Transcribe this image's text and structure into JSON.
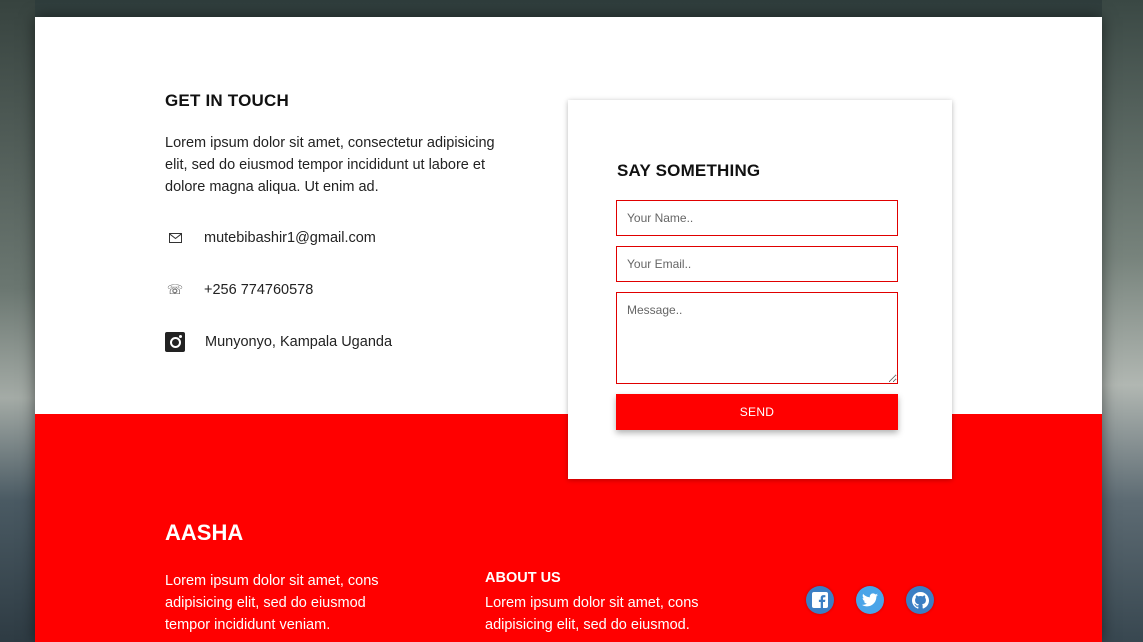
{
  "contact": {
    "title": "GET IN TOUCH",
    "description": "Lorem ipsum dolor sit amet, consectetur adipisicing elit, sed do eiusmod tempor incididunt ut labore et dolore magna aliqua. Ut enim ad.",
    "email": "mutebibashir1@gmail.com",
    "phone": "+256 774760578",
    "location": "Munyonyo, Kampala Uganda"
  },
  "form": {
    "title": "SAY SOMETHING",
    "name_placeholder": "Your Name..",
    "email_placeholder": "Your Email..",
    "message_placeholder": "Message..",
    "send_label": "SEND"
  },
  "footer": {
    "brand": "AASHA",
    "brand_text": "Lorem ipsum dolor sit amet, cons adipisicing elit, sed do eiusmod tempor incididunt veniam.",
    "about_title": "ABOUT US",
    "about_text": "Lorem ipsum dolor sit amet, cons adipisicing elit, sed do eiusmod."
  },
  "icons": {
    "email": "envelope-icon",
    "phone": "phone-icon",
    "location": "instagram-icon",
    "social": [
      "facebook-icon",
      "twitter-icon",
      "github-icon"
    ]
  },
  "colors": {
    "accent": "#ff0000",
    "field_border": "#e00000",
    "social_circle": "#3b7fc4",
    "text_dark": "#111111"
  }
}
